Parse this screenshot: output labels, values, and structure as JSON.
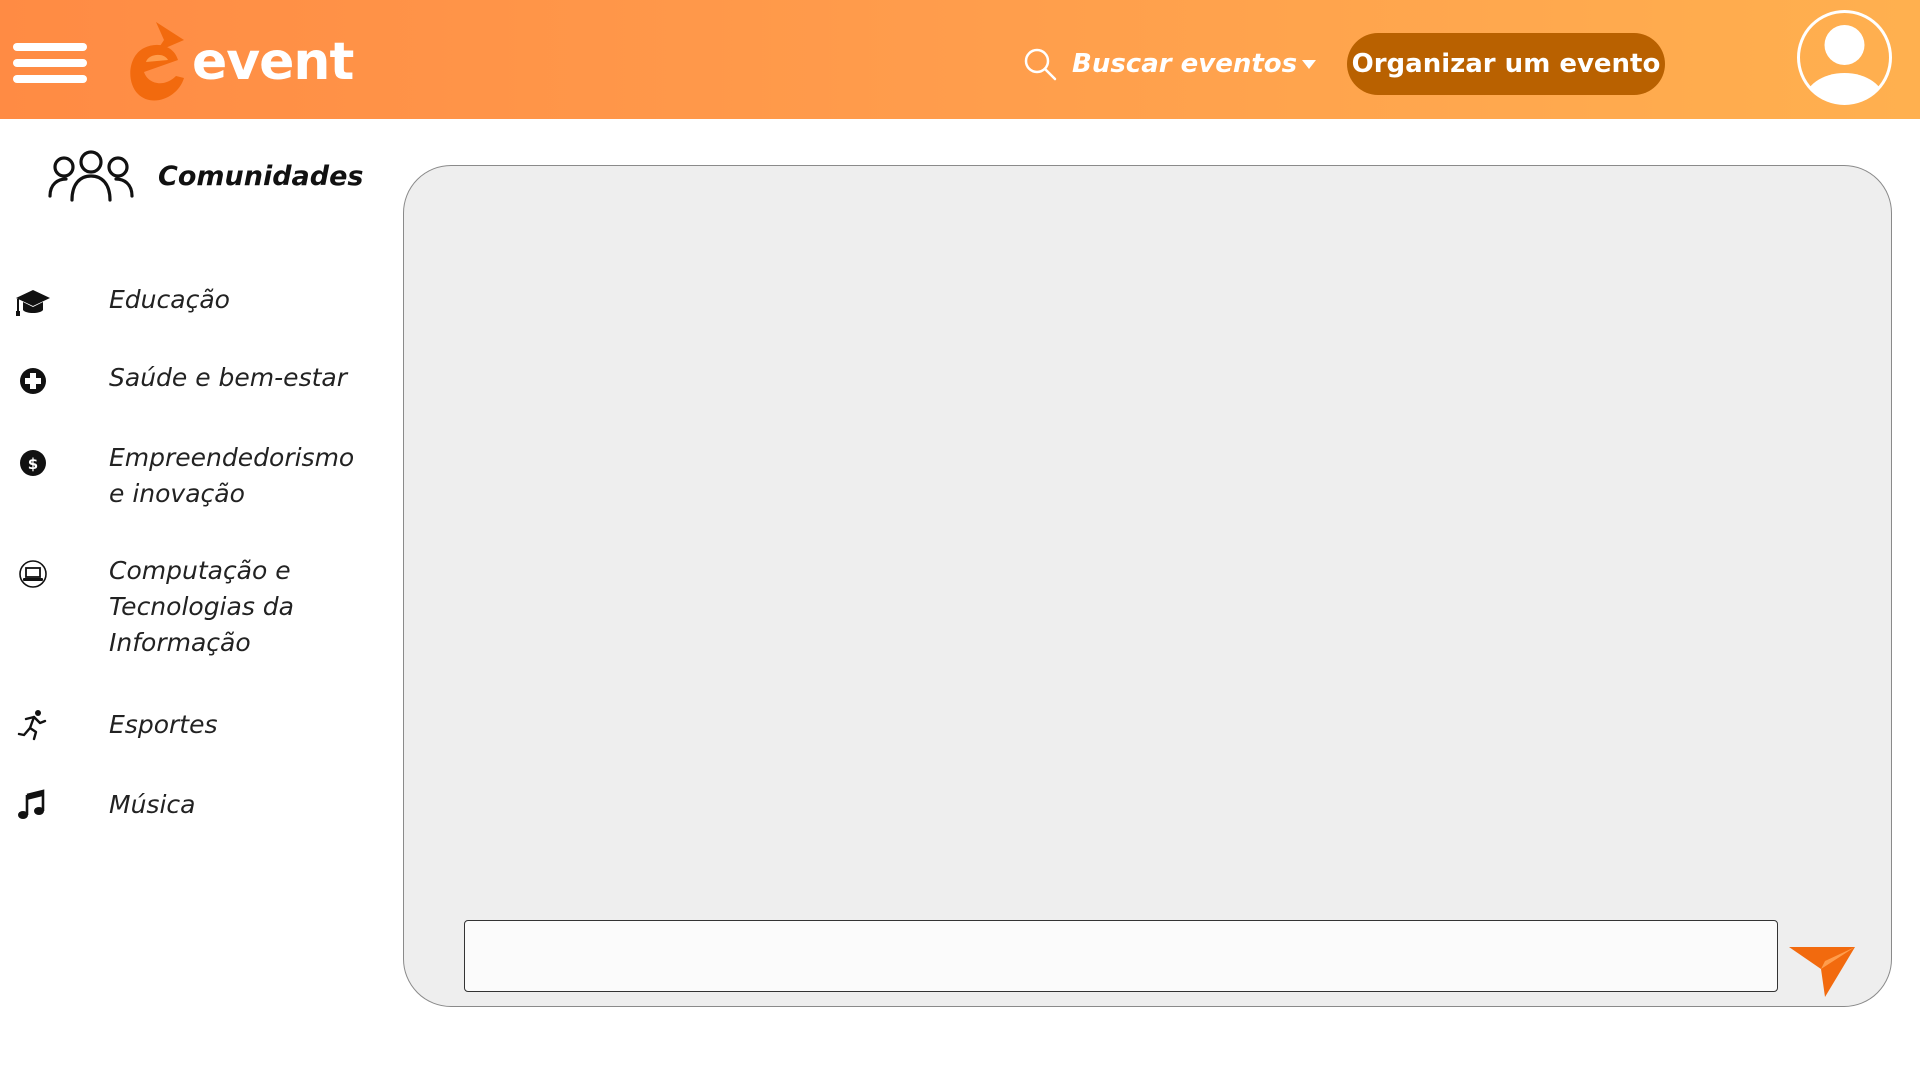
{
  "header": {
    "brand": "event",
    "search_label": "Buscar eventos",
    "organize_label": "Organizar um evento"
  },
  "sidebar": {
    "title": "Comunidades",
    "items": [
      {
        "label": "Educação",
        "icon": "graduation-cap-icon"
      },
      {
        "label": "Saúde e bem-estar",
        "icon": "medical-cross-icon"
      },
      {
        "label": "Empreendedorismo e inovação",
        "icon": "dollar-coin-icon"
      },
      {
        "label": "Computação e Tecnologias da Informação",
        "icon": "laptop-icon"
      },
      {
        "label": "Esportes",
        "icon": "runner-icon"
      },
      {
        "label": "Música",
        "icon": "music-note-icon"
      }
    ]
  },
  "chat": {
    "input_value": "",
    "input_placeholder": ""
  },
  "colors": {
    "header_gradient_start": "#ff8b44",
    "header_gradient_end": "#ffb04f",
    "organize_button": "#b96100",
    "accent_orange": "#f26a0e",
    "panel_background": "#eeeeee"
  }
}
